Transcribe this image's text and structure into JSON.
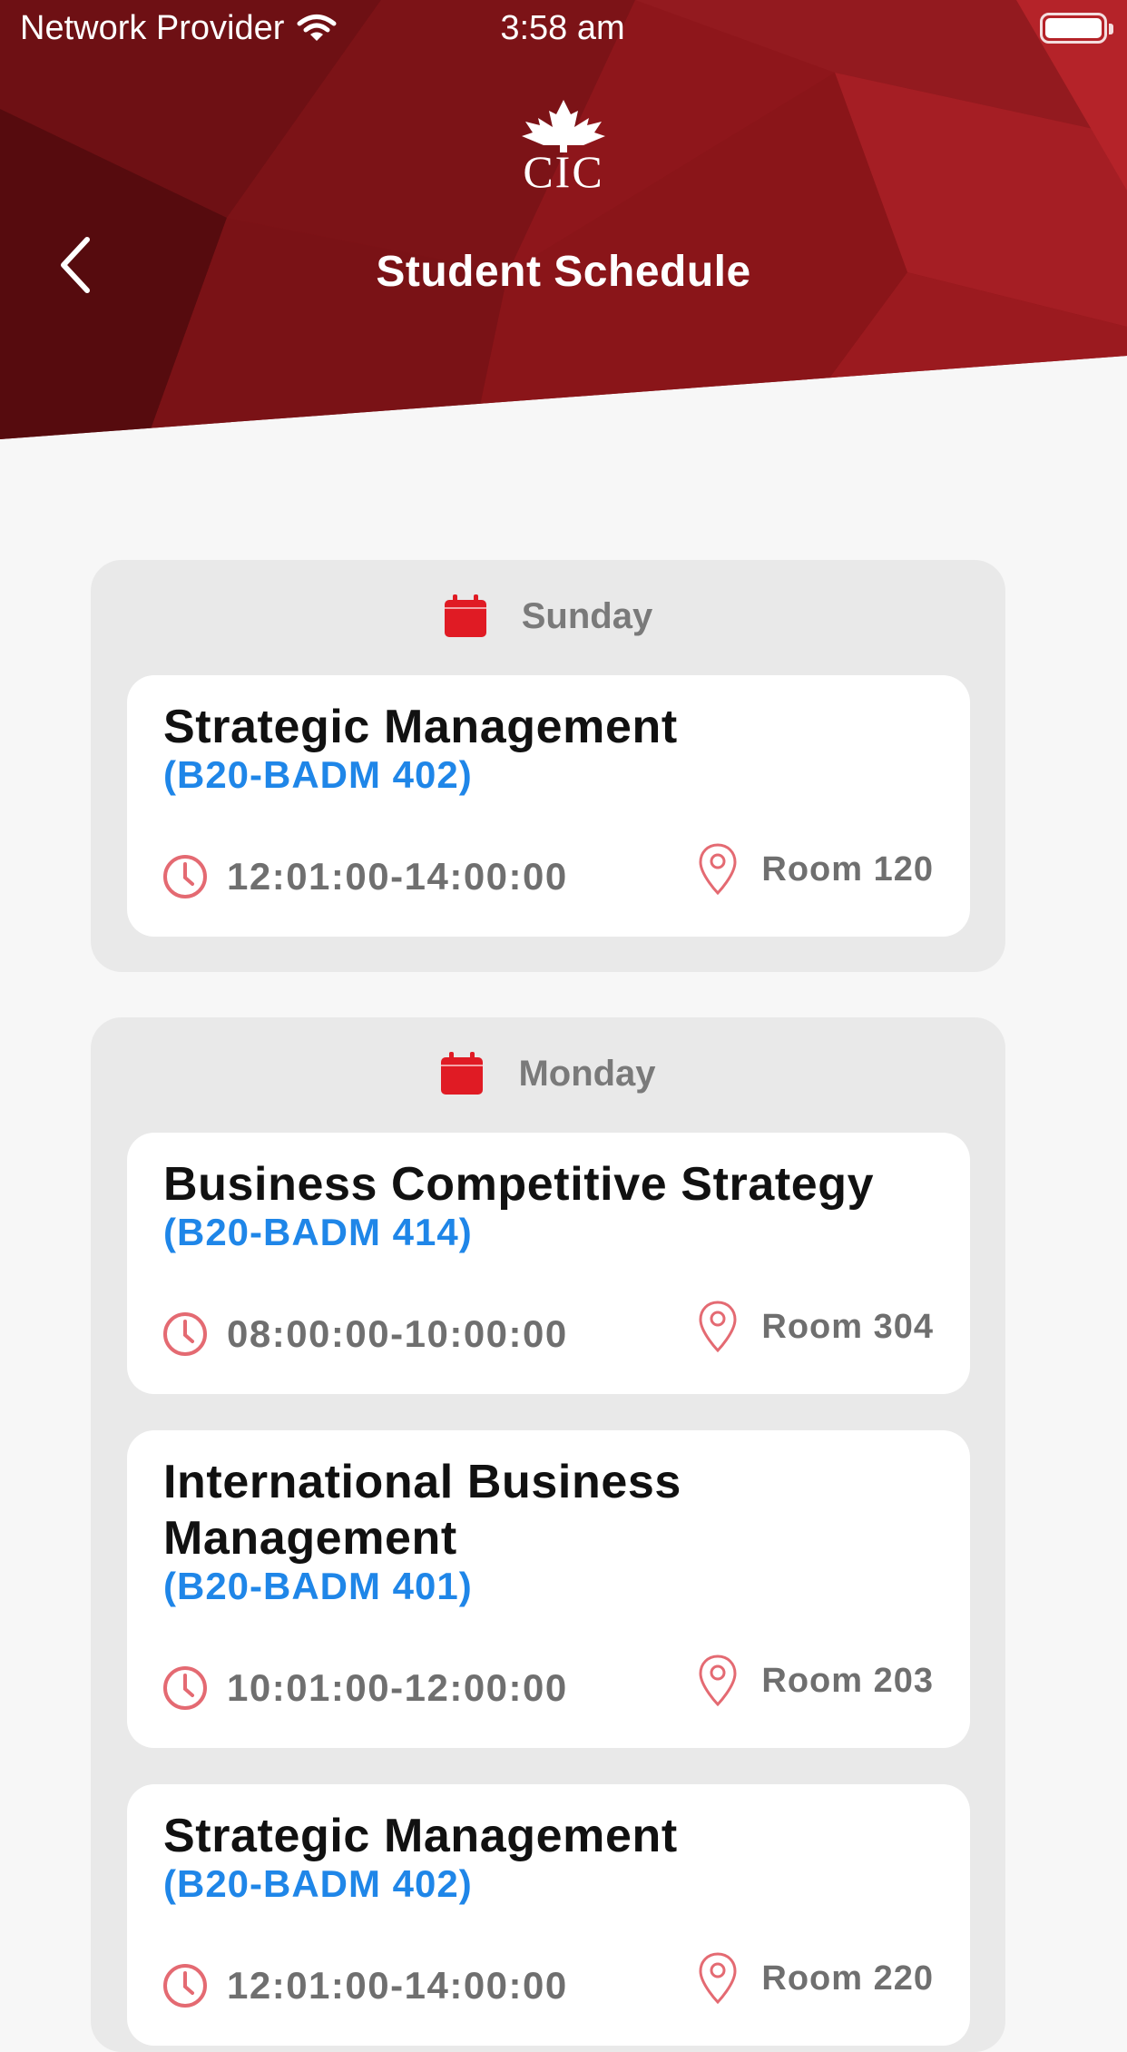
{
  "status_bar": {
    "carrier": "Network Provider",
    "time": "3:58 am"
  },
  "header": {
    "logo_text": "CIC",
    "title": "Student Schedule"
  },
  "colors": {
    "brand_red": "#b01c22",
    "calendar_red": "#e01b24",
    "code_blue": "#1f86e8",
    "icon_pink": "#e46a72"
  },
  "icons": {
    "back": "chevron-left-icon",
    "calendar": "calendar-icon",
    "clock": "clock-icon",
    "location": "map-pin-icon",
    "logo": "maple-leaf-icon",
    "wifi": "wifi-icon",
    "battery": "battery-icon"
  },
  "days": [
    {
      "day": "Sunday",
      "classes": [
        {
          "title": "Strategic Management",
          "code": "(B20-BADM 402)",
          "time": "12:01:00-14:00:00",
          "room": "Room 120"
        }
      ]
    },
    {
      "day": "Monday",
      "classes": [
        {
          "title": "Business Competitive Strategy",
          "code": "(B20-BADM 414)",
          "time": "08:00:00-10:00:00",
          "room": "Room 304"
        },
        {
          "title": "International Business Management",
          "code": "(B20-BADM 401)",
          "time": "10:01:00-12:00:00",
          "room": "Room 203"
        },
        {
          "title": "Strategic Management",
          "code": "(B20-BADM 402)",
          "time": "12:01:00-14:00:00",
          "room": "Room 220"
        }
      ]
    }
  ]
}
